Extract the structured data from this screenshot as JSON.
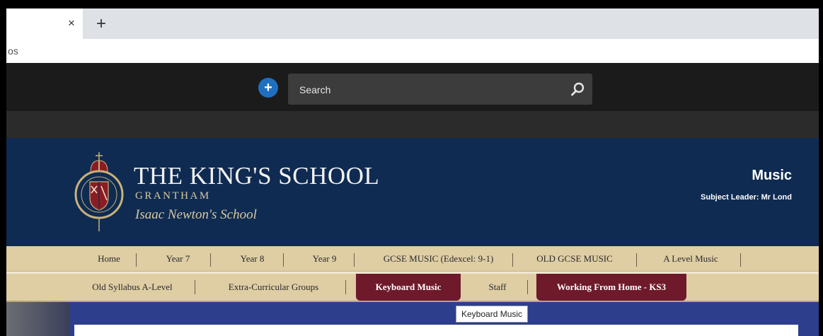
{
  "browser": {
    "tab_close": "×",
    "new_tab": "+",
    "bookmarks_text": "os"
  },
  "topbar": {
    "plus_icon": "plus-circle-icon",
    "search_placeholder": "Search",
    "search_icon": "search-icon",
    "accent": "#1f6fc0"
  },
  "header": {
    "school_name": "THE KING'S SCHOOL",
    "town": "GRANTHAM",
    "motto": "Isaac Newton's School",
    "subject": "Music",
    "leader": "Subject Leader: Mr Lond",
    "bg": "#0f2b52"
  },
  "nav": {
    "row1": [
      "Home",
      "Year 7",
      "Year 8",
      "Year 9",
      "GCSE MUSIC (Edexcel: 9-1)",
      "OLD GCSE MUSIC",
      "A Level Music"
    ],
    "row2": [
      "Old Syllabus A-Level",
      "Extra-Curricular Groups",
      "Keyboard Music",
      "Staff",
      "Working From Home - KS3"
    ],
    "active_color": "#6e1a2b"
  },
  "tooltip": {
    "text": "Keyboard Music"
  }
}
